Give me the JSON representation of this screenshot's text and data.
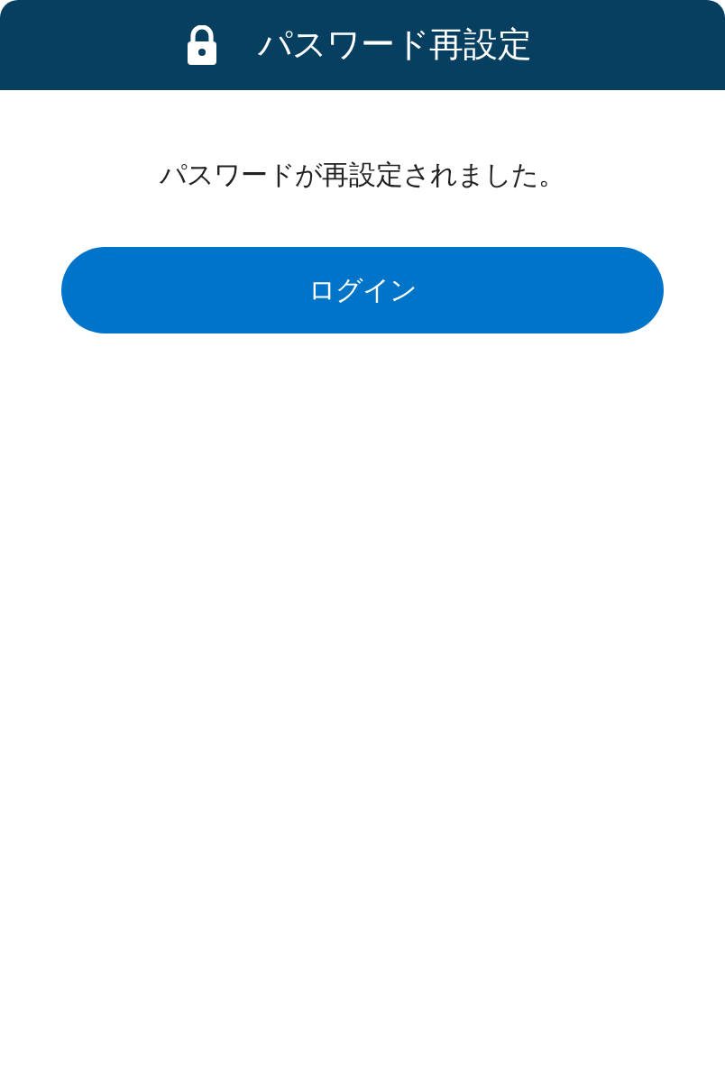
{
  "header": {
    "title": "パスワード再設定"
  },
  "message": "パスワードが再設定されました。",
  "login_button": {
    "label": "ログイン"
  }
}
